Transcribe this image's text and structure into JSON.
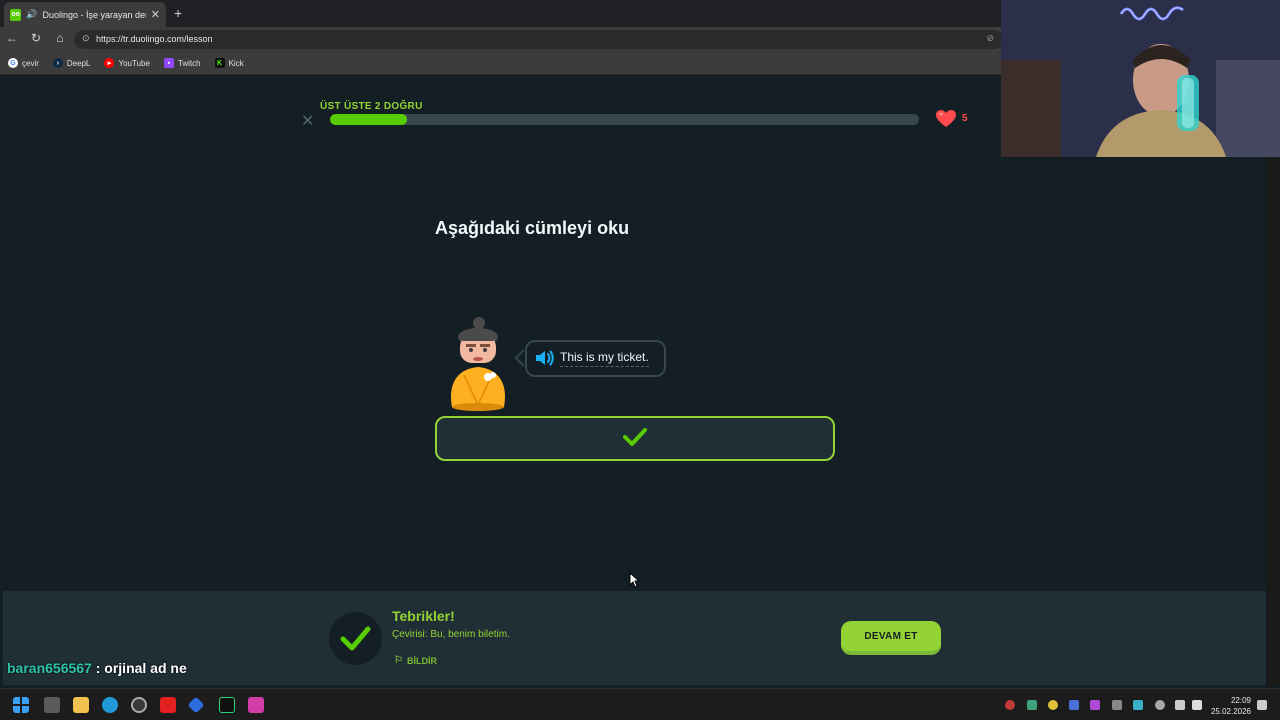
{
  "browser": {
    "tab_title": "Duolingo - İşe yarayan dersler",
    "url": "https://tr.duolingo.com/lesson",
    "bookmarks": [
      {
        "label": "çevir",
        "icon": "google-icon"
      },
      {
        "label": "DeepL",
        "icon": "deepl-icon"
      },
      {
        "label": "YouTube",
        "icon": "youtube-icon"
      },
      {
        "label": "Twitch",
        "icon": "twitch-icon"
      },
      {
        "label": "Kick",
        "icon": "kick-icon"
      }
    ]
  },
  "lesson": {
    "streak_label": "ÜST ÜSTE 2 DOĞRU",
    "progress_fraction": 0.13,
    "hearts": "5",
    "prompt_title": "Aşağıdaki cümleyi oku",
    "sentence": "This is my ticket."
  },
  "feedback": {
    "title": "Tebrikler!",
    "translation": "Çevirisi: Bu, benim biletim.",
    "report_label": "BİLDİR",
    "continue_label": "DEVAM ET"
  },
  "chat": {
    "username": "baran656567",
    "message": " : orjinal ad ne"
  },
  "taskbar": {
    "time": "22:09",
    "date": "25.02.2026"
  },
  "colors": {
    "background": "#131f24",
    "accent_green": "#58cc02",
    "correct_green": "#93d333",
    "heart_red": "#ff4b4b"
  }
}
